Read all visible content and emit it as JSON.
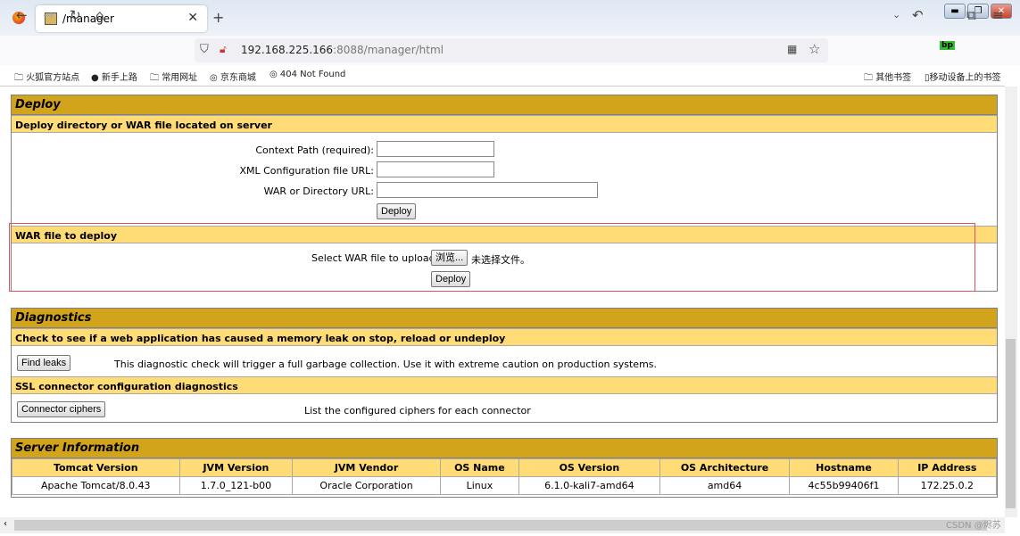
{
  "browser": {
    "tab_title": "/manager",
    "url_host": "192.168.225.166",
    "url_rest": ":8088/manager/html",
    "bookmarks": [
      "火狐官方站点",
      "新手上路",
      "常用网址",
      "京东商城",
      "404 Not Found"
    ],
    "bookmarks_right": [
      "其他书签",
      "移动设备上的书签"
    ]
  },
  "deploy": {
    "title": "Deploy",
    "server_section": "Deploy directory or WAR file located on server",
    "context_label": "Context Path (required):",
    "context_value": "",
    "xml_label": "XML Configuration file URL:",
    "xml_value": "",
    "war_dir_label": "WAR or Directory URL:",
    "war_dir_value": "",
    "deploy_button": "Deploy",
    "upload_section": "WAR file to deploy",
    "select_label": "Select WAR file to upload",
    "browse_button": "浏览...",
    "no_file": "未选择文件。",
    "upload_deploy_button": "Deploy"
  },
  "diagnostics": {
    "title": "Diagnostics",
    "leak_section": "Check to see if a web application has caused a memory leak on stop, reload or undeploy",
    "find_leaks_button": "Find leaks",
    "leak_desc": "This diagnostic check will trigger a full garbage collection. Use it with extreme caution on production systems.",
    "ssl_section": "SSL connector configuration diagnostics",
    "ciphers_button": "Connector ciphers",
    "ciphers_desc": "List the configured ciphers for each connector"
  },
  "server": {
    "title": "Server Information",
    "headers": [
      "Tomcat Version",
      "JVM Version",
      "JVM Vendor",
      "OS Name",
      "OS Version",
      "OS Architecture",
      "Hostname",
      "IP Address"
    ],
    "values": [
      "Apache Tomcat/8.0.43",
      "1.7.0_121-b00",
      "Oracle Corporation",
      "Linux",
      "6.1.0-kali7-amd64",
      "amd64",
      "4c55b99406f1",
      "172.25.0.2"
    ]
  },
  "watermark": "CSDN @烬苏",
  "colors": {
    "header": "#D2A41C",
    "subheader": "#FFDC75",
    "highlight": "#e05060"
  }
}
